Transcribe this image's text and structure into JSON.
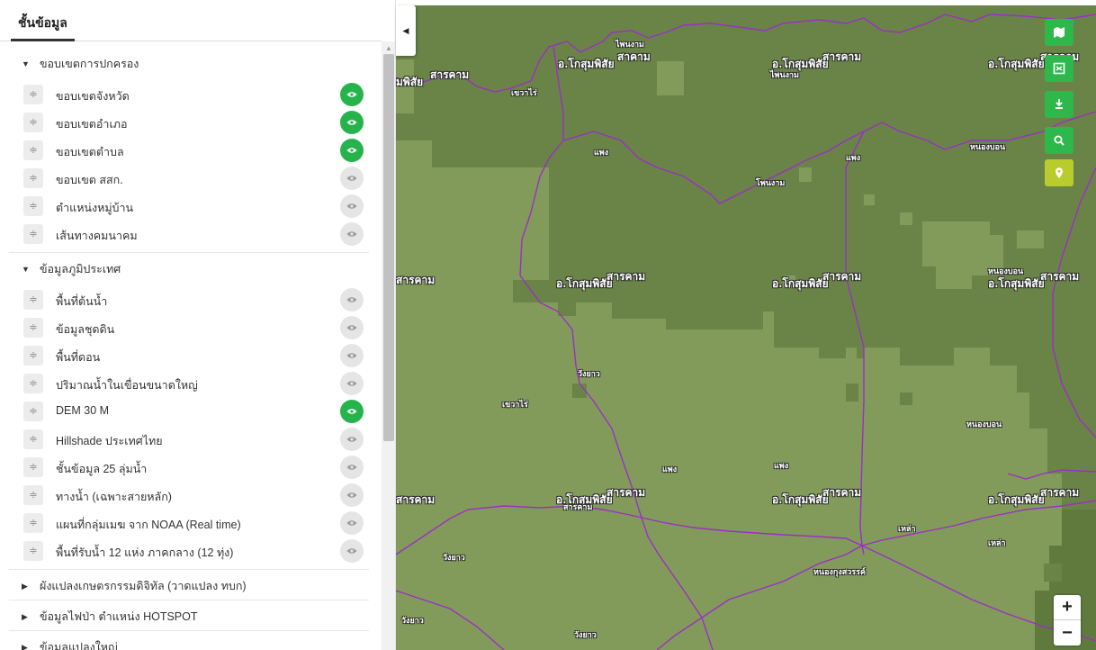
{
  "sidebar": {
    "tab_label": "ชั้นข้อมูล",
    "groups": [
      {
        "label": "ขอบเขตการปกครอง",
        "expanded": true,
        "layers": [
          {
            "label": "ขอบเขตจังหวัด",
            "visible": true
          },
          {
            "label": "ขอบเขตอำเภอ",
            "visible": true
          },
          {
            "label": "ขอบเขตตำบล",
            "visible": true
          },
          {
            "label": "ขอบเขต สสก.",
            "visible": false
          },
          {
            "label": "ตำแหน่งหมู่บ้าน",
            "visible": false
          },
          {
            "label": "เส้นทางคมนาคม",
            "visible": false
          }
        ]
      },
      {
        "label": "ข้อมูลภูมิประเทศ",
        "expanded": true,
        "layers": [
          {
            "label": "พื้นที่ต้นน้ำ",
            "visible": false
          },
          {
            "label": "ข้อมูลชุดดิน",
            "visible": false
          },
          {
            "label": "พื้นที่ดอน",
            "visible": false
          },
          {
            "label": "ปริมาณน้ำในเขื่อนขนาดใหญ่",
            "visible": false
          },
          {
            "label": "DEM 30 M",
            "visible": true
          },
          {
            "label": "Hillshade ประเทศไทย",
            "visible": false
          },
          {
            "label": "ชั้นข้อมูล 25 ลุ่มน้ำ",
            "visible": false
          },
          {
            "label": "ทางน้ำ (เฉพาะสายหลัก)",
            "visible": false
          },
          {
            "label": "แผนที่กลุ่มเมฆ จาก NOAA (Real time)",
            "visible": false
          },
          {
            "label": "พื้นที่รับน้ำ 12 แห่ง ภาคกลาง (12 ทุ่ง)",
            "visible": false
          }
        ]
      },
      {
        "label": "ผังแปลงเกษตรกรรมดิจิทัล (วาดแปลง ทบก)",
        "expanded": false,
        "layers": []
      },
      {
        "label": "ข้อมูลไฟป่า ตำแหน่ง HOTSPOT",
        "expanded": false,
        "layers": []
      },
      {
        "label": "ข้อมูลแปลงใหญ่",
        "expanded": false,
        "layers": []
      }
    ]
  },
  "icons": {
    "collapse": "triangle-left-icon",
    "drag": "drag-handle-icon",
    "eye": "eye-icon",
    "caret_open": "caret-down-icon",
    "caret_closed": "caret-right-icon"
  },
  "map": {
    "labels": {
      "l01": "ไพนงาม",
      "l02": "สาคาม",
      "l03": "อ.โกสุมพิสัย",
      "l04": "สารคาม",
      "l05": "อ.โกสุมพิสัย",
      "l06": "ไพนงาม",
      "l07": "สารคาม",
      "l08": "อ.โกสุมพิสัย",
      "l09": "สารคาม",
      "l10": "มพิสัย",
      "l11": "สารคาม",
      "l12": "เขวาไร่",
      "l13": "แพง",
      "l14": "แพง",
      "l15": "หนองบอน",
      "l16": "โพนงาม",
      "l17": "สารคาม",
      "l18": "อ.โกสุมพิสัย",
      "l19": "สารคาม",
      "l20": "อ.โกสุมพิสัย",
      "l21": "สารคาม",
      "l22": "หนองบอน",
      "l23": "อ.โกสุมพิสัย",
      "l24": "สารคาม",
      "l25": "วังยาว",
      "l26": "เขวาไร่",
      "l27": "หนองบอน",
      "l28": "แพง",
      "l29": "แพง",
      "l30": "สารคาม",
      "l31": "อ.โกสุมพิสัย",
      "l32": "สารคาม",
      "l33": "อ.โกสุมพิสัย",
      "l34": "สารคาม",
      "l35": "อ.โกสุมพิสัย",
      "l36": "สารคาม",
      "l37": "เหล่า",
      "l38": "เหล่า",
      "l39": "หนองกุงสวรรค์",
      "l40": "วังยาว",
      "l41": "วังยาว",
      "l42": "วังยาว"
    },
    "colors": {
      "dark_terrain": "#6a8447",
      "light_terrain": "#829b5b",
      "boundary": "#9b2fc7"
    }
  },
  "toolbar": {
    "buttons": [
      {
        "icon": "map-icon"
      },
      {
        "icon": "layers-icon"
      },
      {
        "icon": "download-icon"
      },
      {
        "icon": "search-icon"
      },
      {
        "icon": "pin-icon"
      }
    ]
  },
  "zoom": {
    "in_label": "+",
    "out_label": "−"
  }
}
